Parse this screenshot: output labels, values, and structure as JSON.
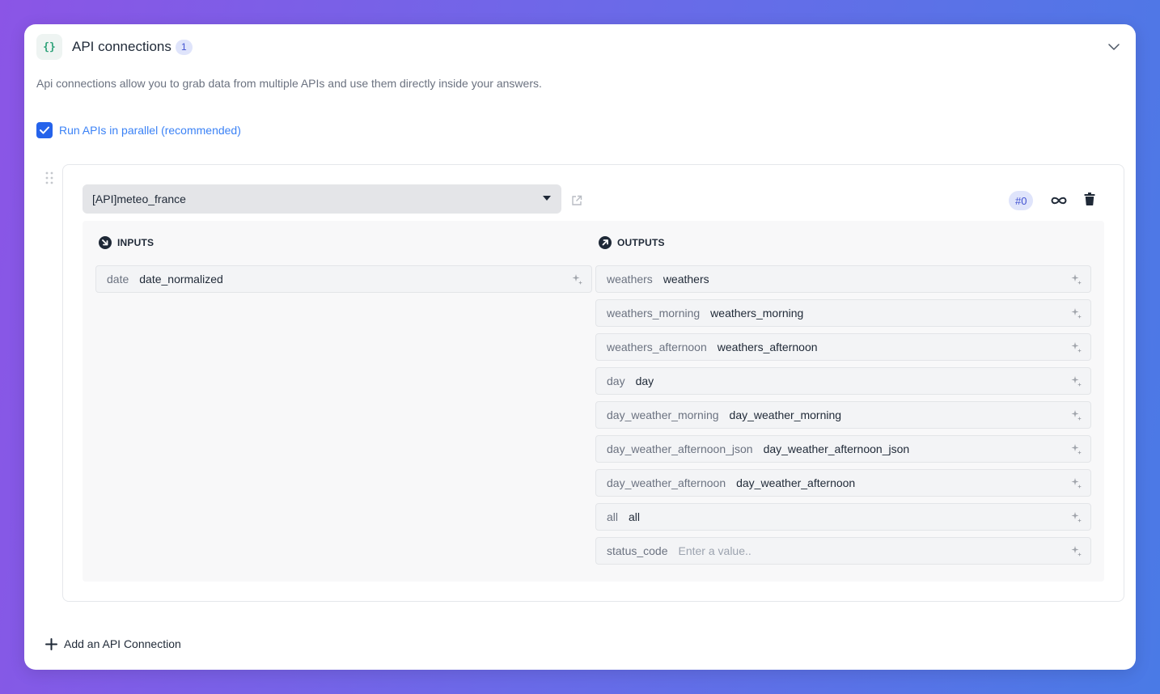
{
  "header": {
    "icon": "braces-icon",
    "title": "API connections",
    "count": "1"
  },
  "description": "Api connections allow you to grab data from multiple APIs and use them directly inside your answers.",
  "parallel": {
    "checked": true,
    "label": "Run APIs in parallel (recommended)"
  },
  "connection": {
    "api_name": "[API]meteo_france",
    "index_badge": "#0",
    "inputs_label": "INPUTS",
    "outputs_label": "OUTPUTS",
    "inputs": [
      {
        "name": "date",
        "value": "date_normalized",
        "placeholder": ""
      }
    ],
    "outputs": [
      {
        "name": "weathers",
        "value": "weathers",
        "placeholder": ""
      },
      {
        "name": "weathers_morning",
        "value": "weathers_morning",
        "placeholder": ""
      },
      {
        "name": "weathers_afternoon",
        "value": "weathers_afternoon",
        "placeholder": ""
      },
      {
        "name": "day",
        "value": "day",
        "placeholder": ""
      },
      {
        "name": "day_weather_morning",
        "value": "day_weather_morning",
        "placeholder": ""
      },
      {
        "name": "day_weather_afternoon_json",
        "value": "day_weather_afternoon_json",
        "placeholder": ""
      },
      {
        "name": "day_weather_afternoon",
        "value": "day_weather_afternoon",
        "placeholder": ""
      },
      {
        "name": "all",
        "value": "all",
        "placeholder": ""
      },
      {
        "name": "status_code",
        "value": "",
        "placeholder": "Enter a value.."
      }
    ]
  },
  "add_button": {
    "label": "Add an API Connection"
  },
  "colors": {
    "accent": "#2563eb",
    "badge_bg": "#dfe4fb",
    "badge_text": "#4252d1",
    "link": "#3b82f6"
  }
}
